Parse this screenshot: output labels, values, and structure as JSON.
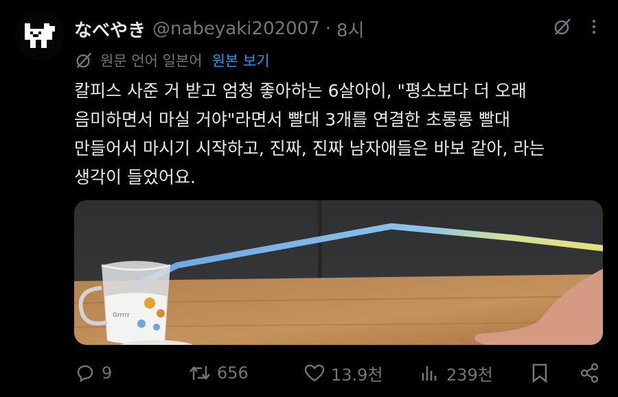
{
  "tweet": {
    "display_name": "なべやき",
    "handle": "@nabeyaki202007",
    "separator": "·",
    "time": "8시",
    "translation_note": "원문 언어 일본어",
    "show_original": "원본 보기",
    "text": "칼피스 사준 거 받고 엄청 좋아하는 6살아이, \"평소보다 더 오래\n음미하면서 마실 거야\"라면서 빨대 3개를 연결한 초롱롱 빨대\n만들어서 마시기 시작하고, 진짜, 진짜 남자애들은 바보 같아, 라는\n생각이 들었어요.",
    "media_cup_text": "Grrrrr"
  },
  "actions": {
    "replies": "9",
    "retweets": "656",
    "likes": "13.9천",
    "views": "239천"
  },
  "icons": [
    "dog-avatar",
    "grok-icon",
    "more-icon",
    "translate-icon",
    "reply-icon",
    "retweet-icon",
    "like-icon",
    "views-icon",
    "bookmark-icon",
    "share-icon"
  ],
  "colors": {
    "background": "#000000",
    "text": "#e7e9ea",
    "muted": "#71767b",
    "link": "#1d9bf0"
  }
}
